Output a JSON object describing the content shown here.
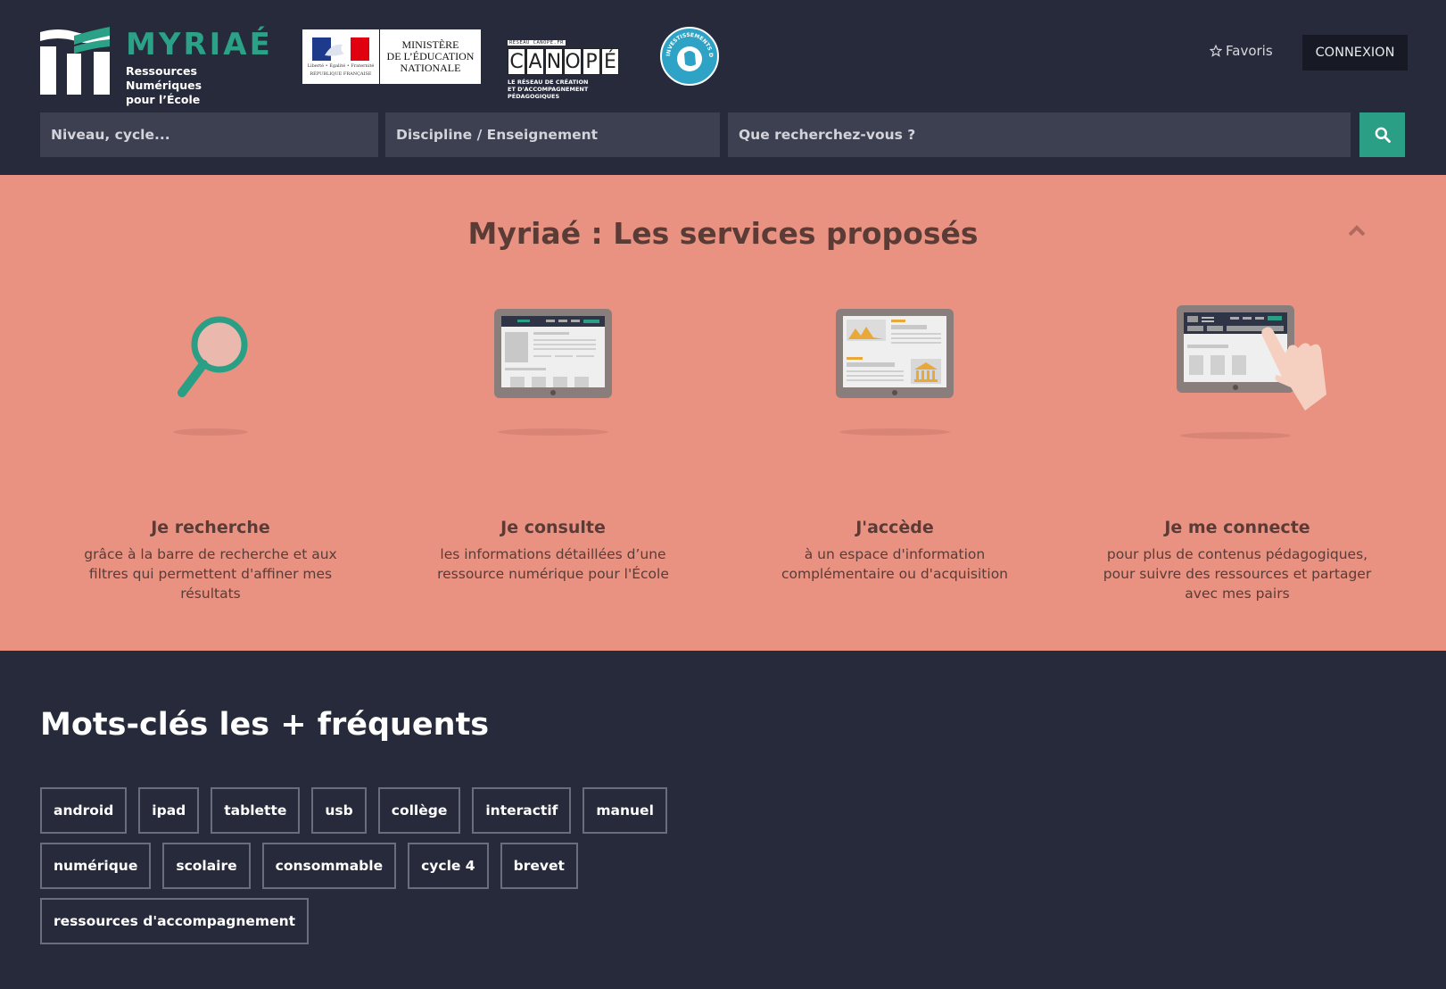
{
  "header": {
    "logo": {
      "name": "MYRIAÉ",
      "tagline_1": "Ressources Numériques",
      "tagline_2": "pour l’École"
    },
    "ministry_logo": {
      "text": "MINISTÈRE\nDE L’ÉDUCATION\nNATIONALE",
      "motto": "Liberté • Égalité • Fraternité",
      "republic": "RÉPUBLIQUE FRANÇAISE"
    },
    "canope_logo": {
      "top": "RÉSEAU CANOPÉ.FR",
      "letters": [
        "C",
        "A",
        "N",
        "O",
        "P",
        "É"
      ],
      "subtitle": "LE RÉSEAU DE CRÉATION\nET D'ACCOMPAGNEMENT PÉDAGOGIQUES"
    },
    "pia_logo": {
      "text": "INVESTISSEMENTS D'AVENIR"
    },
    "favorites_label": "Favoris",
    "login_label": "CONNEXION",
    "filters": {
      "level_placeholder": "Niveau, cycle...",
      "discipline_placeholder": "Discipline / Enseignement",
      "search_placeholder": "Que recherchez-vous ?"
    }
  },
  "services": {
    "title": "Myriaé : Les services proposés",
    "items": [
      {
        "name": "Je recherche",
        "description": "grâce à la barre de recherche et aux filtres qui permettent d'affiner mes résultats",
        "icon": "magnifier-icon"
      },
      {
        "name": "Je consulte",
        "description": "les informations détaillées d’une ressource numérique pour l'École",
        "icon": "tablet-page-icon"
      },
      {
        "name": "J'accède",
        "description": "à un espace d'information complémentaire ou d'acquisition",
        "icon": "tablet-info-icon"
      },
      {
        "name": "Je me connecte",
        "description": "pour plus de contenus pédagogiques, pour suivre des ressources et partager avec mes pairs",
        "icon": "tablet-touch-icon"
      }
    ]
  },
  "keywords": {
    "title": "Mots-clés les + fréquents",
    "rows": [
      [
        "android",
        "ipad",
        "tablette",
        "usb",
        "collège",
        "interactif",
        "manuel"
      ],
      [
        "numérique",
        "scolaire",
        "consommable",
        "cycle 4",
        "brevet"
      ],
      [
        "ressources d'accompagnement"
      ]
    ]
  },
  "colors": {
    "header_bg": "#262a3a",
    "accent_green": "#2ba287",
    "services_bg": "#e99282",
    "services_text": "#5a3b36"
  }
}
